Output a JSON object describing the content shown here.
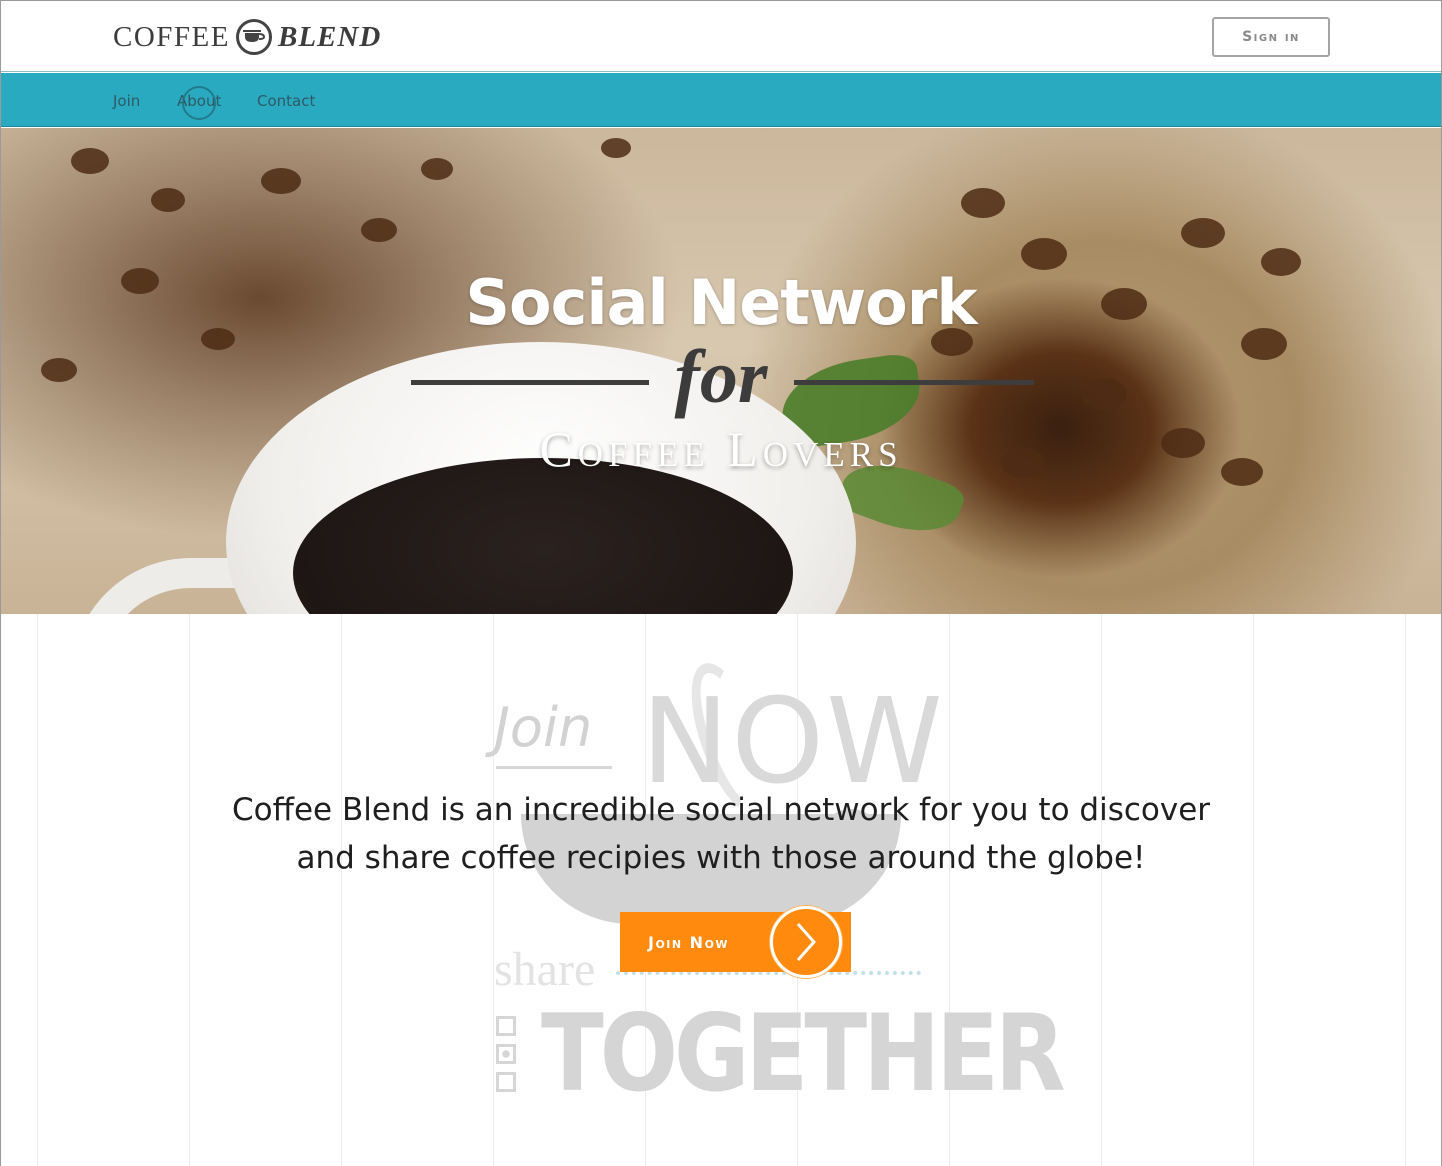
{
  "header": {
    "logo_word1": "COFFEE",
    "logo_icon": "coffee-cup-icon",
    "logo_word2": "BLEND",
    "signin_label": "Sign in"
  },
  "nav": {
    "items": [
      {
        "label": "Join"
      },
      {
        "label": "About"
      },
      {
        "label": "Contact"
      }
    ]
  },
  "hero": {
    "title": "Social Network",
    "for": "for",
    "subtitle": "Coffee Lovers"
  },
  "watermark": {
    "join": "Join",
    "now": "NOW",
    "share": "share",
    "together": "TOGETHER"
  },
  "intro": {
    "text": "Coffee Blend is an incredible social network for you to discover and share coffee recipies with those around the globe!"
  },
  "cta": {
    "label": "Join Now",
    "icon": "chevron-right-icon"
  },
  "colors": {
    "nav_bg": "#2aaac0",
    "cta_bg": "#ff8a0d"
  }
}
